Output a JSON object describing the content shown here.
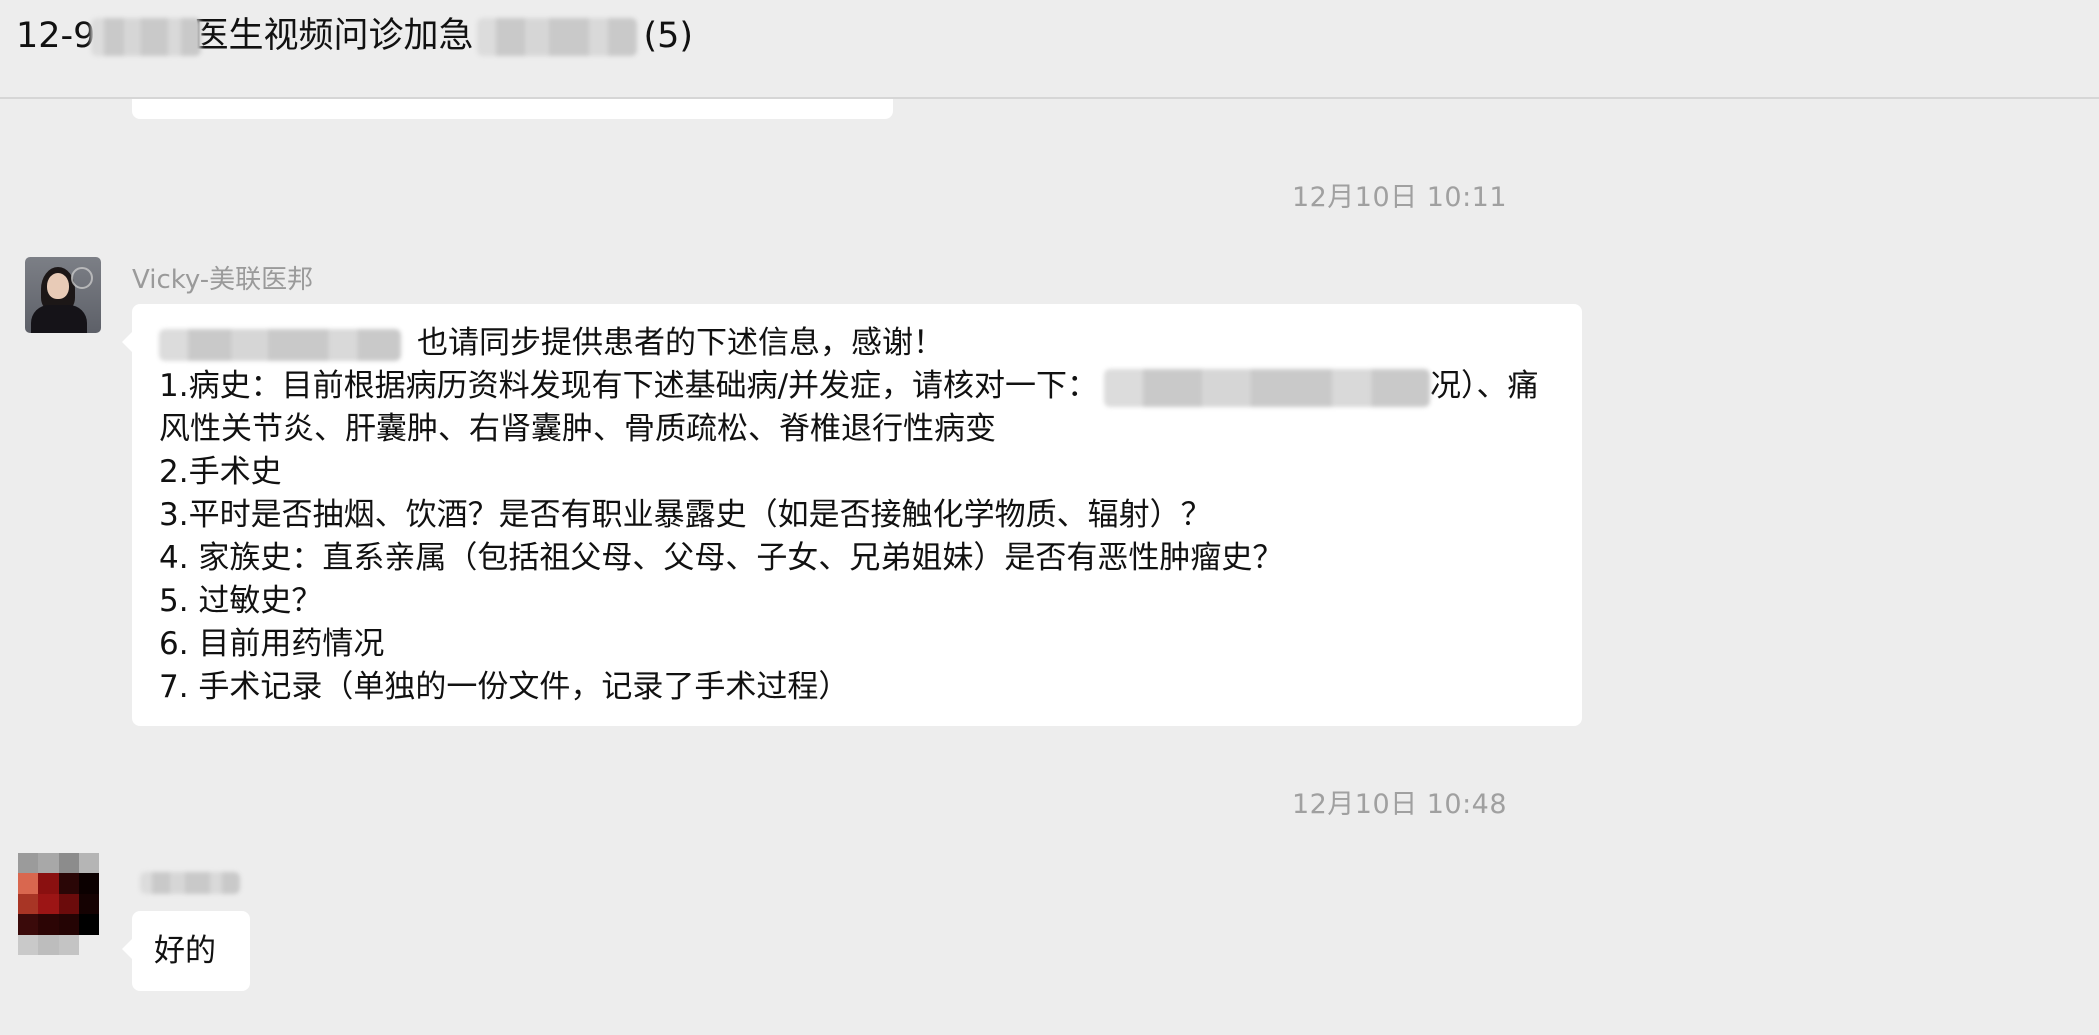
{
  "window": {
    "title_prefix": "12-9",
    "title_middle": "医生视频问诊加急",
    "title_suffix": "(5)"
  },
  "chat": {
    "messages": [
      {
        "timestamp": "12月10日 10:11",
        "sender": "Vicky-美联医邦",
        "lines": [
          "也请同步提供患者的下述信息，感谢！",
          "1.病史：目前根据病历资料发现有下述基础病/并发症，请核对一下：",
          "况）、痛",
          "风性关节炎、肝囊肿、右肾囊肿、骨质疏松、脊椎退行性病变",
          "2.手术史",
          "3.平时是否抽烟、饮酒？是否有职业暴露史（如是否接触化学物质、辐射）？",
          "4. 家族史：直系亲属（包括祖父母、父母、子女、兄弟姐妹）是否有恶性肿瘤史？",
          "5. 过敏史？",
          "6. 目前用药情况",
          "7. 手术记录（单独的一份文件，记录了手术过程）"
        ]
      },
      {
        "timestamp": "12月10日 10:48",
        "text": "好的"
      }
    ]
  },
  "colors": {
    "background": "#ededed",
    "bubble": "#ffffff",
    "timestamp_text": "#a0a0a0",
    "sender_text": "#9a9a9a"
  }
}
